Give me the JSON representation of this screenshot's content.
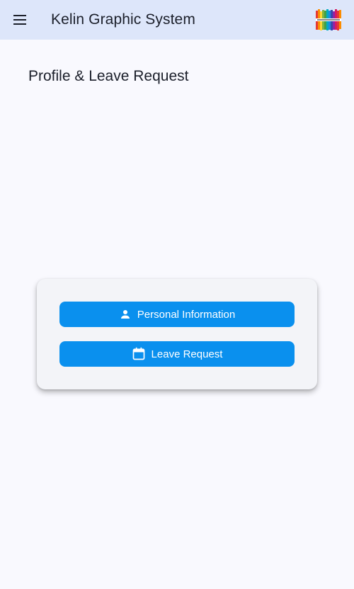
{
  "app_bar": {
    "title": "Kelin Graphic System",
    "menu_icon": "hamburger-menu-icon",
    "logo_icon": "color-bars-logo-icon",
    "background": "#dde6fa"
  },
  "page": {
    "title": "Profile & Leave Request"
  },
  "card": {
    "buttons": [
      {
        "label": "Personal Information",
        "icon": "person-icon"
      },
      {
        "label": "Leave Request",
        "icon": "calendar-icon"
      }
    ],
    "button_color": "#0a90ee"
  }
}
